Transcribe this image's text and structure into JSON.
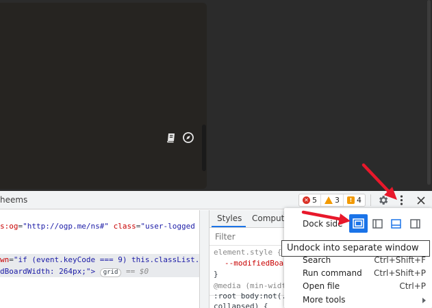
{
  "devtools": {
    "tab_label": "heems",
    "counters": {
      "errors": "5",
      "warnings": "3",
      "info": "4"
    }
  },
  "elements": {
    "line1_attr": "s:og",
    "line1_eq": "=",
    "line1_val": "\"http://ogp.me/ns#\"",
    "line1_attr2": " class",
    "line1_eq2": "=",
    "line1_val2": "\"user-logged",
    "line3_attr": "wn",
    "line3_eq": "=",
    "line3_val": "\"if (event.keyCode === 9) this.classList.",
    "line4_val": "dBoardWidth: 264px;\">",
    "grid_badge": "grid",
    "dollar0": "== $0"
  },
  "styles": {
    "tab_styles": "Styles",
    "tab_computed": "Compute",
    "filter_placeholder": "Filter",
    "element_style": "element.style {",
    "modified_prop": "--modifiedBoa",
    "close_brace": "}",
    "media_rule": "@media (min-widt",
    "root_rule": ":root body:not(.",
    "collapsed_rule": "collapsed) {"
  },
  "menu": {
    "dock_side_label": "Dock side",
    "tooltip": "Undock into separate window",
    "items": [
      {
        "label": "Search",
        "shortcut": "Ctrl+Shift+F"
      },
      {
        "label": "Run command",
        "shortcut": "Ctrl+Shift+P"
      },
      {
        "label": "Open file",
        "shortcut": "Ctrl+P"
      },
      {
        "label": "More tools",
        "shortcut": ""
      }
    ]
  },
  "colors": {
    "accent": "#1a73e8",
    "annotation_arrow": "#e8182b",
    "error": "#d93025",
    "warning": "#f29900"
  },
  "icons": {
    "board_left": "book-icon",
    "board_right": "compass-icon",
    "settings": "gear-icon",
    "more": "kebab-menu-icon",
    "close": "close-icon"
  }
}
